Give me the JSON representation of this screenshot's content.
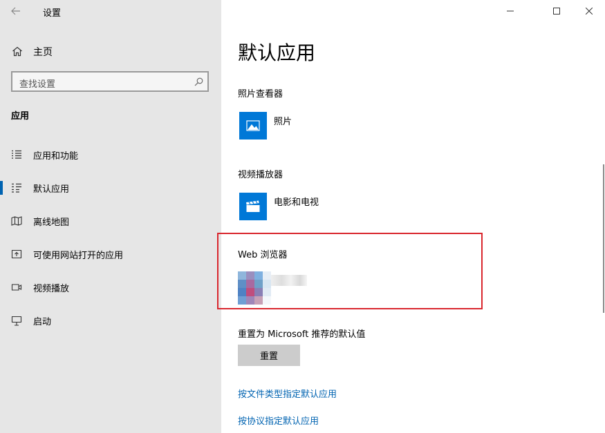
{
  "window": {
    "title": "设置"
  },
  "sidebar": {
    "home_label": "主页",
    "search_placeholder": "查找设置",
    "section_title": "应用",
    "items": [
      {
        "label": "应用和功能",
        "icon": "apps-list-icon"
      },
      {
        "label": "默认应用",
        "icon": "default-apps-icon",
        "active": true
      },
      {
        "label": "离线地图",
        "icon": "map-icon"
      },
      {
        "label": "可使用网站打开的应用",
        "icon": "open-in-icon"
      },
      {
        "label": "视频播放",
        "icon": "video-icon"
      },
      {
        "label": "启动",
        "icon": "startup-icon"
      }
    ]
  },
  "main": {
    "title": "默认应用",
    "photo_viewer": {
      "label": "照片查看器",
      "app": "照片"
    },
    "video_player": {
      "label": "视频播放器",
      "app": "电影和电视"
    },
    "web_browser": {
      "label": "Web 浏览器"
    },
    "reset": {
      "label": "重置为 Microsoft 推荐的默认值",
      "button": "重置"
    },
    "links": [
      "按文件类型指定默认应用",
      "按协议指定默认应用"
    ]
  },
  "colors": {
    "accent": "#0078d7",
    "link": "#0063b1",
    "highlight_border": "#d9262d",
    "sidebar_bg": "#e6e6e6"
  }
}
